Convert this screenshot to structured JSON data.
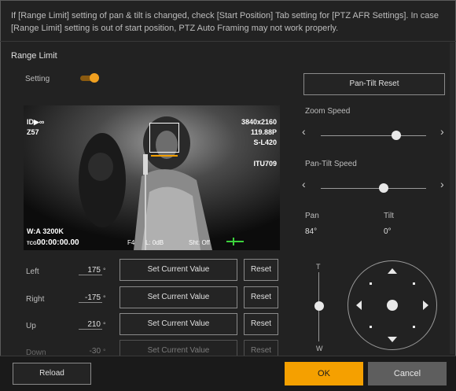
{
  "notice": "If [Range Limit] setting of pan & tilt is changed, check [Start Position] Tab setting for [PTZ AFR Settings]. In case [Range Limit] setting is out of start position, PTZ Auto Framing may not work properly.",
  "section_title": "Range Limit",
  "setting_label": "Setting",
  "setting_on": true,
  "pan_tilt_reset_label": "Pan-Tilt Reset",
  "overlay": {
    "top_left_icons": "ID▶∞",
    "top_left_code": "Z57",
    "resolution": "3840x2160",
    "frame_rate": "119.88P",
    "codec": "S-L420",
    "color_space": "ITU709",
    "wb": "W:A",
    "kelvin": "3200K",
    "timecode_prefix": "TCG",
    "timecode": "00:00:00.00",
    "iris": "F4",
    "level": "L: 0dB",
    "shutter": "Sht: Off"
  },
  "limits": [
    {
      "label": "Left",
      "value": "175",
      "unit": "°"
    },
    {
      "label": "Right",
      "value": "-175",
      "unit": "°"
    },
    {
      "label": "Up",
      "value": "210",
      "unit": "°"
    },
    {
      "label": "Down",
      "value": "-30",
      "unit": "°"
    }
  ],
  "set_current_label": "Set Current Value",
  "reset_label": "Reset",
  "zoom_speed_label": "Zoom Speed",
  "zoom_speed_level": 0.72,
  "pantilt_speed_label": "Pan-Tilt Speed",
  "pantilt_speed_level": 0.6,
  "pan_label": "Pan",
  "pan_value": "84°",
  "tilt_label": "Tilt",
  "tilt_value": "0°",
  "zoom_t": "T",
  "zoom_w": "W",
  "footer": {
    "reload": "Reload",
    "ok": "OK",
    "cancel": "Cancel"
  },
  "colors": {
    "accent": "#f5a000",
    "cancel": "#5e5e5e"
  }
}
